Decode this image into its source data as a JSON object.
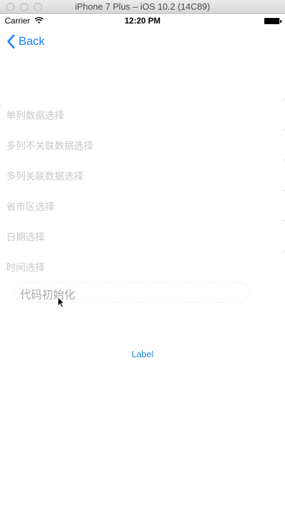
{
  "window": {
    "title": "iPhone 7 Plus – iOS 10.2 (14C89)"
  },
  "status_bar": {
    "carrier": "Carrier",
    "time": "12:20 PM"
  },
  "nav": {
    "back_label": "Back"
  },
  "list": [
    {
      "label": "单列数据选择"
    },
    {
      "label": "多列不关联数据选择"
    },
    {
      "label": "多列关联数据选择"
    },
    {
      "label": "省市区选择"
    },
    {
      "label": "日期选择"
    },
    {
      "label": "时间选择"
    }
  ],
  "init_button": {
    "label": "代码初始化"
  },
  "label_text": "Label",
  "colors": {
    "accent": "#147efb",
    "list_text": "#c8c8c8",
    "label": "#1c8ddc"
  }
}
